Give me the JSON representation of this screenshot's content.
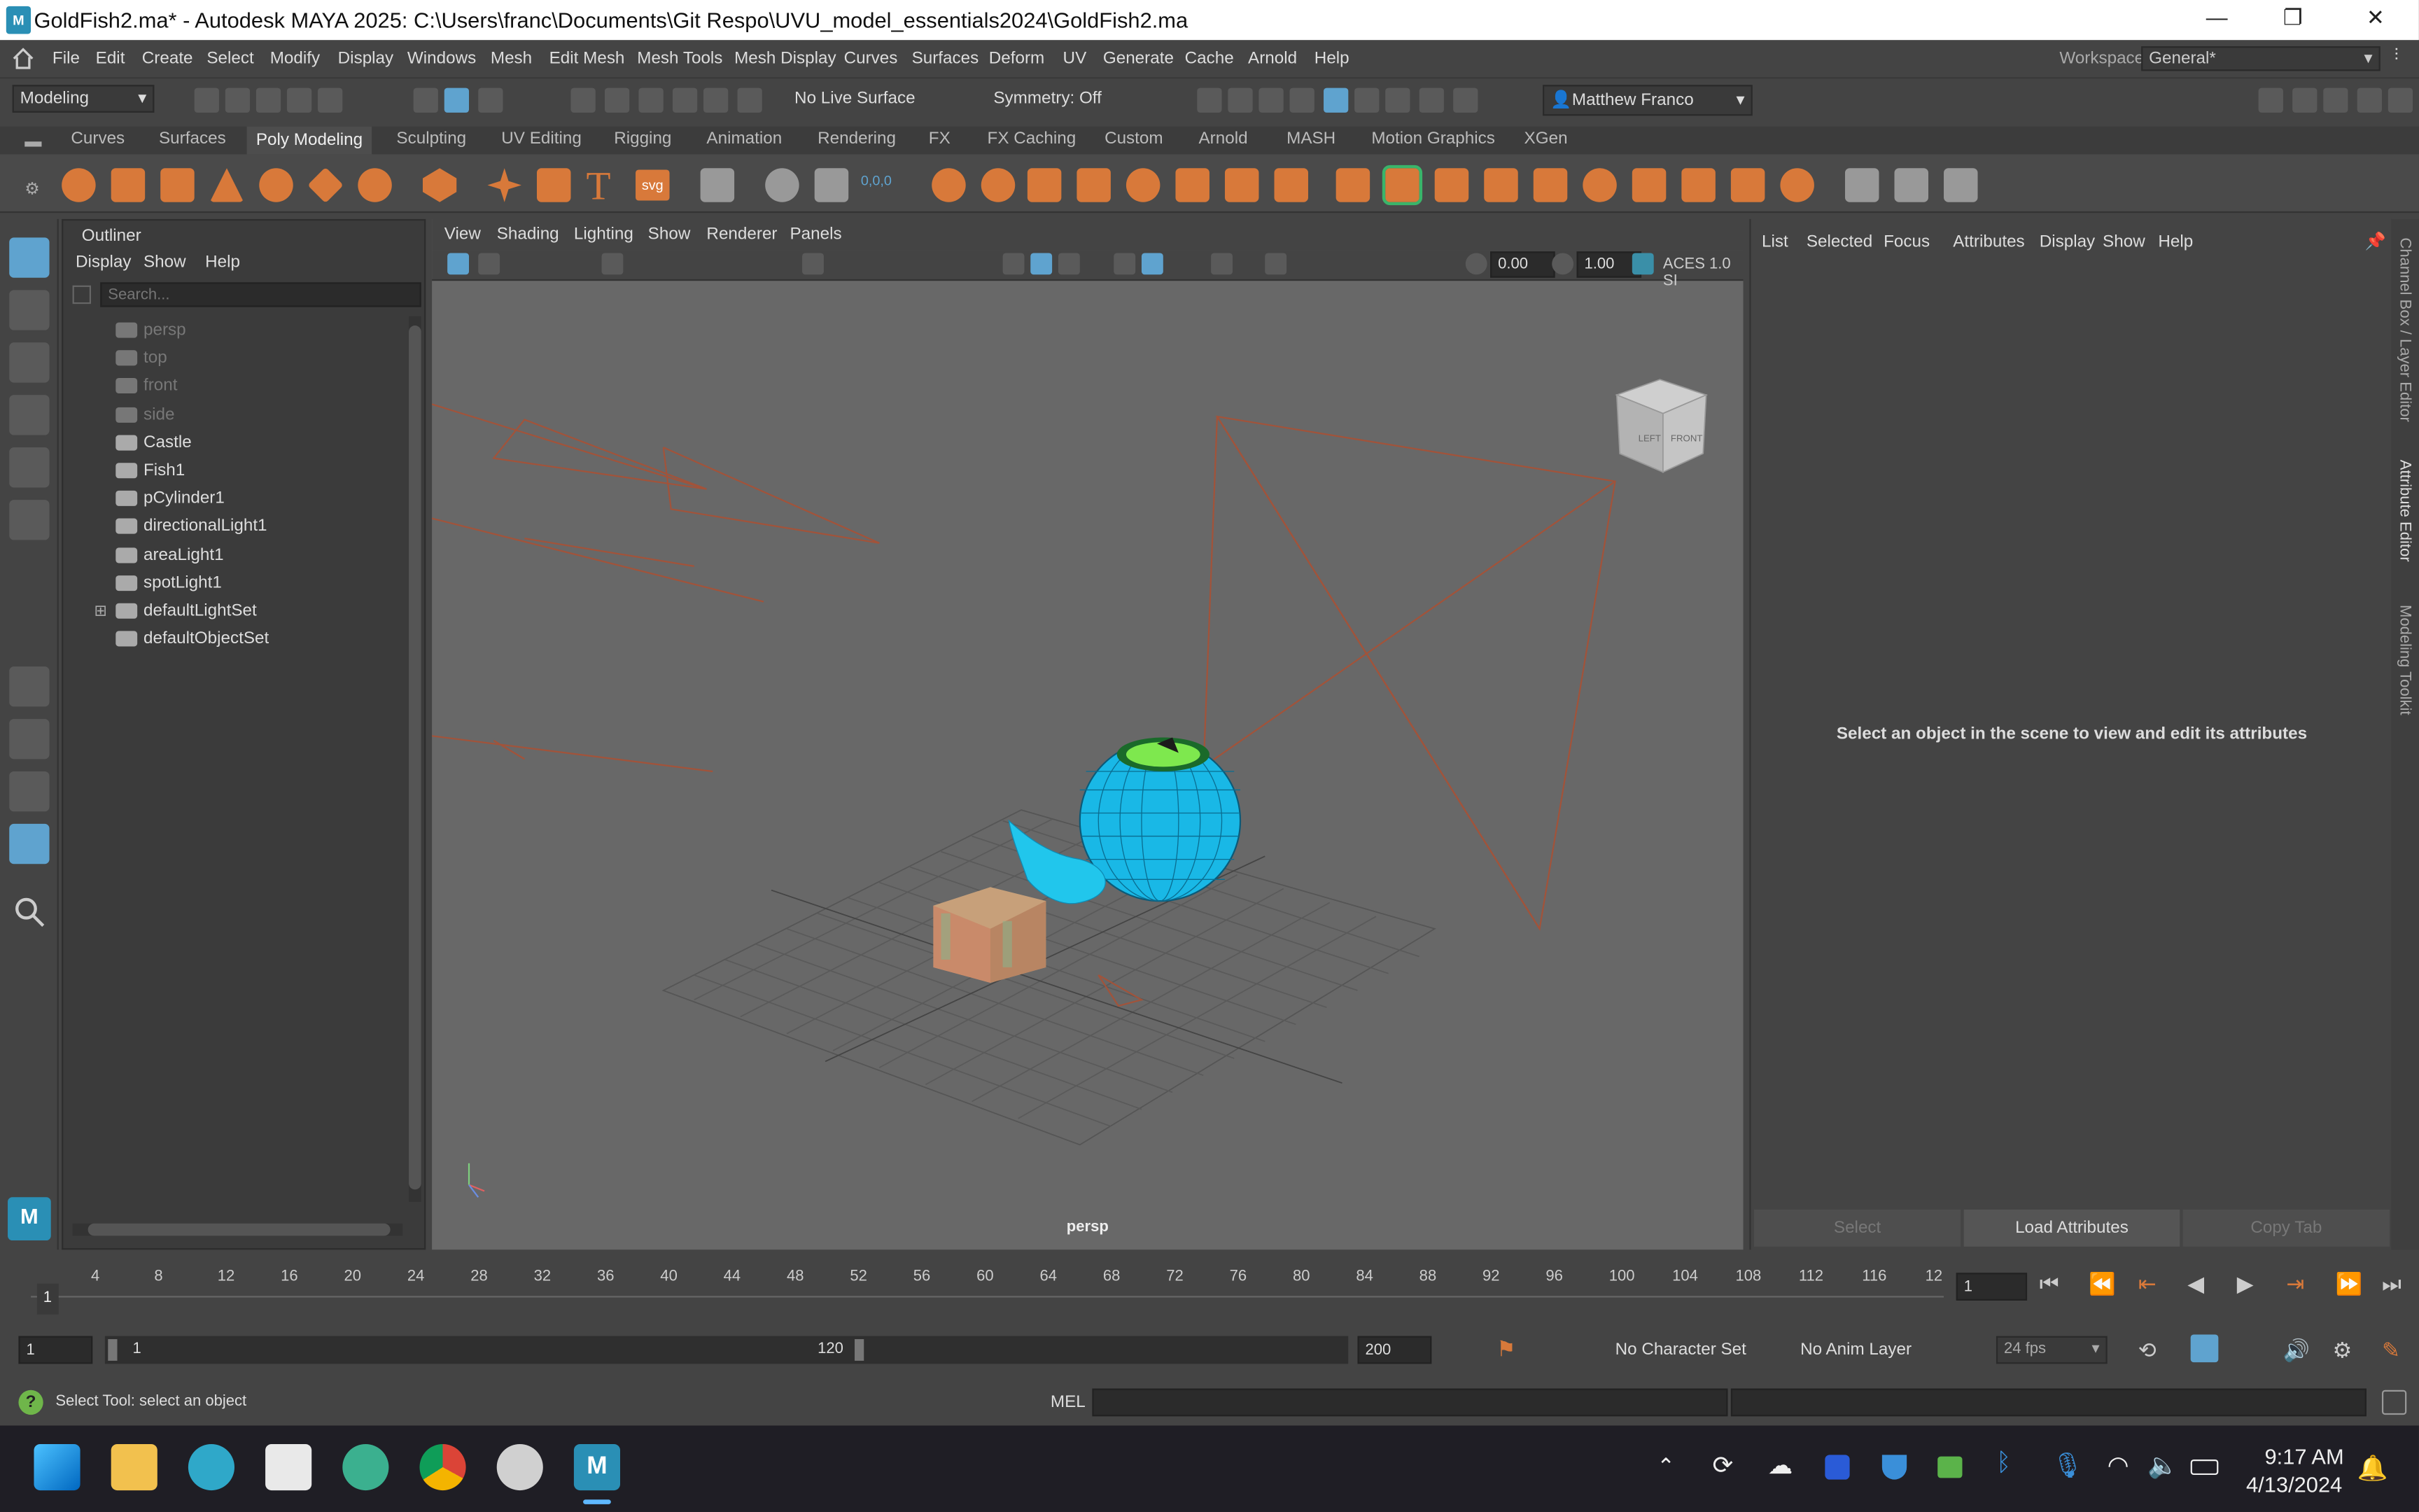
{
  "window": {
    "title": "GoldFish2.ma* - Autodesk MAYA 2025: C:\\Users\\franc\\Documents\\Git Respo\\UVU_model_essentials2024\\GoldFish2.ma",
    "logo": "M",
    "minimize": "—",
    "restore": "❐",
    "close": "✕"
  },
  "menubar": {
    "items": [
      "File",
      "Edit",
      "Create",
      "Select",
      "Modify",
      "Display",
      "Windows",
      "Mesh",
      "Edit Mesh",
      "Mesh Tools",
      "Mesh Display",
      "Curves",
      "Surfaces",
      "Deform",
      "UV",
      "Generate",
      "Cache",
      "Arnold",
      "Help"
    ],
    "workspace_label": "Workspace:",
    "workspace_value": "General*"
  },
  "statusline": {
    "mode": "Modeling",
    "live_surface": "No Live Surface",
    "symmetry": "Symmetry: Off",
    "user": "Matthew Franco"
  },
  "shelf": {
    "tabs": [
      "Curves",
      "Surfaces",
      "Poly Modeling",
      "Sculpting",
      "UV Editing",
      "Rigging",
      "Animation",
      "Rendering",
      "FX",
      "FX Caching",
      "Custom",
      "Arnold",
      "MASH",
      "Motion Graphics",
      "XGen"
    ],
    "active": "Poly Modeling",
    "text_tool": "T",
    "svg_tool": "svg",
    "coords": "0,0,0"
  },
  "outliner": {
    "title": "Outliner",
    "menu": [
      "Display",
      "Show",
      "Help"
    ],
    "search_placeholder": "Search...",
    "items": [
      {
        "label": "persp",
        "dim": true,
        "icon": "camera-icon"
      },
      {
        "label": "top",
        "dim": true,
        "icon": "camera-icon"
      },
      {
        "label": "front",
        "dim": true,
        "icon": "camera-icon"
      },
      {
        "label": "side",
        "dim": true,
        "icon": "camera-icon"
      },
      {
        "label": "Castle",
        "dim": false,
        "icon": "mesh-icon"
      },
      {
        "label": "Fish1",
        "dim": false,
        "icon": "mesh-icon"
      },
      {
        "label": "pCylinder1",
        "dim": false,
        "icon": "mesh-icon"
      },
      {
        "label": "directionalLight1",
        "dim": false,
        "icon": "directional-light-icon"
      },
      {
        "label": "areaLight1",
        "dim": false,
        "icon": "area-light-icon"
      },
      {
        "label": "spotLight1",
        "dim": false,
        "icon": "spot-light-icon"
      },
      {
        "label": "defaultLightSet",
        "dim": false,
        "icon": "set-icon",
        "expandable": true
      },
      {
        "label": "defaultObjectSet",
        "dim": false,
        "icon": "set-icon"
      }
    ]
  },
  "viewport": {
    "menu": [
      "View",
      "Shading",
      "Lighting",
      "Show",
      "Renderer",
      "Panels"
    ],
    "exposure": "0.00",
    "gamma": "1.00",
    "color_space": "ACES 1.0 SI",
    "camera_label": "persp",
    "cube_left": "LEFT",
    "cube_front": "FRONT"
  },
  "attribute_editor": {
    "menu": [
      "List",
      "Selected",
      "Focus",
      "Attributes",
      "Display",
      "Show",
      "Help"
    ],
    "message": "Select an object in the scene to view and edit its attributes",
    "buttons": [
      "Select",
      "Load Attributes",
      "Copy Tab"
    ]
  },
  "side_tabs": [
    "Channel Box / Layer Editor",
    "Attribute Editor",
    "Modeling Toolkit"
  ],
  "timeline": {
    "ticks": [
      "4",
      "8",
      "12",
      "16",
      "20",
      "24",
      "28",
      "32",
      "36",
      "40",
      "44",
      "48",
      "52",
      "56",
      "60",
      "64",
      "68",
      "72",
      "76",
      "80",
      "84",
      "88",
      "92",
      "96",
      "100",
      "104",
      "108",
      "112",
      "116",
      "12"
    ],
    "start_marker": "1",
    "current_frame": "1"
  },
  "range": {
    "start": "1",
    "range_start": "1",
    "range_end": "120",
    "end": "200",
    "character_set": "No Character Set",
    "anim_layer": "No Anim Layer",
    "fps": "24 fps"
  },
  "cmdline": {
    "help": "Select Tool: select an object",
    "lang": "MEL"
  },
  "taskbar": {
    "time": "9:17 AM",
    "date": "4/13/2024"
  },
  "colors": {
    "accent": "#d8793a",
    "fish": "#19b8e6",
    "selection": "#5fa3cf"
  }
}
